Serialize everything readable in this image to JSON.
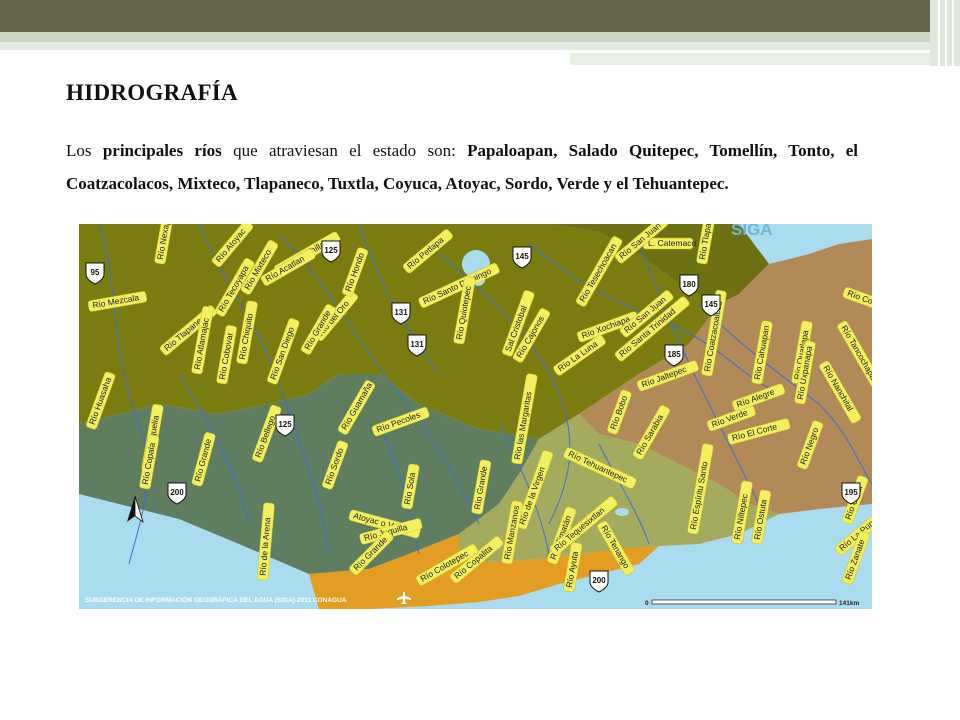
{
  "slide": {
    "title": "HIDROGRAFÍA",
    "para": {
      "s1": "Los ",
      "b1": "principales ríos",
      "s2": " que atraviesan el estado son: ",
      "b2": "Papaloapan, Salado Quitepec, Tomellín, Tonto, el Coatzacolacos, Mixteco, Tlapaneco, Tuxtla, Coyuca, Atoyac, Sordo, Verde y el Tehuantepec."
    }
  },
  "map": {
    "watermark": "SIGA",
    "credit": "SUBGERENCIA DE INFORMACIÓN GEOGRÁFICA DEL AGUA (SIGA)-2011 CONAGUA",
    "scale_start": "0",
    "scale_end": "141km",
    "colors": {
      "sea": "#a9dcef",
      "region_olive": "#7a7c10",
      "region_olive_dark": "#6e7113",
      "region_teal": "#5f7e60",
      "region_sage": "#a5ab5e",
      "region_brown": "#b28a57",
      "region_orange": "#e39d23",
      "river": "#3b6fd6",
      "label_fill": "#f3f060"
    },
    "lake_label": "L. Catemaco",
    "river_labels": [
      "Río Nexapa",
      "Río Atoyac",
      "Río Xolochilla",
      "Río Acatlan",
      "Río Mixteco",
      "Río Tecoyapa",
      "Río Mezcala",
      "Río Tlapaneco",
      "Río Atlamajac",
      "Río Chiquito",
      "Río Cobovar",
      "Río San Diego",
      "Río del Oro",
      "Río Grande",
      "Río Hondo",
      "Río Petlapa",
      "Río Santo Domingo",
      "Río Tesechoacan",
      "Río San Juan",
      "Río Tlapa",
      "Río Xochiapa",
      "Río Santa Trinidad",
      "Río San Juan",
      "Río La Luna",
      "Río Cajonos",
      "Sal Cristobal",
      "Río Quiotepec",
      "Río Guamaña",
      "Río Pecoles",
      "Río Sordo",
      "Río Huasaha",
      "Río Marquelia",
      "Río Copala",
      "Río Grande",
      "Río Bellego",
      "Río Sola",
      "Atoyac o Verde",
      "Río Juquilla",
      "Río de la Arena",
      "Río Grande",
      "Río Colotepec",
      "Río Copalita",
      "Río las Margaritas",
      "Río Grande",
      "Río de la Virgen",
      "Río Manzanos",
      "Río Zimatán",
      "Río Ayuta",
      "Río Tehuantepec",
      "Río Tequesixtlan",
      "Río Tenango",
      "Río Espíritu Santo",
      "Río Niltepec",
      "Río Ostuta",
      "Río Coatzacoalcos",
      "Río Cahuapan",
      "Río Quatlapa",
      "Río Uxpanapa",
      "Río Nanchital",
      "Río Jaltepec",
      "Río Bobo",
      "Río Sarabia",
      "Río Verde",
      "Río Alegre",
      "Río El Corte",
      "Río Negro",
      "Río Tancochapa",
      "Río Catar",
      "Río La Punta",
      "Río Zanate",
      "Río Co"
    ],
    "highway_shields": [
      "95",
      "125",
      "145",
      "131",
      "131",
      "180",
      "145",
      "185",
      "125",
      "200",
      "200",
      "195"
    ]
  }
}
